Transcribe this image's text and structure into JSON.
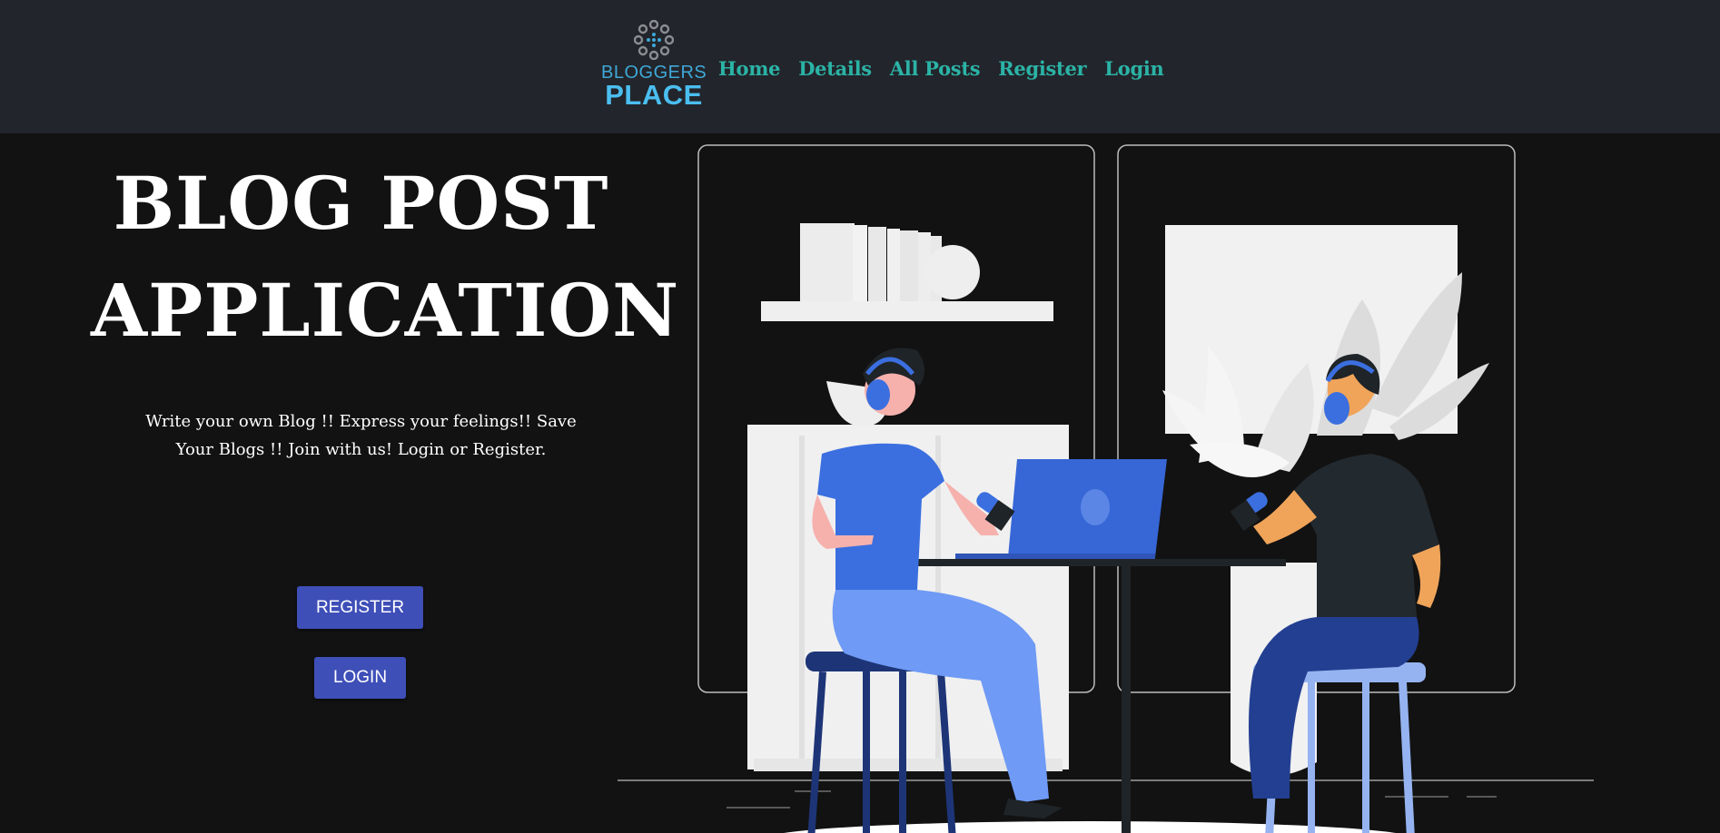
{
  "brand": {
    "line1": "BLOGGERS",
    "line2": "PLACE",
    "icon": "logo-dots-icon"
  },
  "nav": {
    "items": [
      {
        "label": "Home"
      },
      {
        "label": "Details"
      },
      {
        "label": "All Posts"
      },
      {
        "label": "Register"
      },
      {
        "label": "Login"
      }
    ]
  },
  "hero": {
    "title_line1": "BLOG POST",
    "title_line2": "APPLICATION",
    "subtitle": "Write your own Blog !! Express your feelings!! Save Your Blogs !! Join with us! Login or Register.",
    "register_label": "REGISTER",
    "login_label": "LOGIN",
    "illustration": "podcast-illustration"
  },
  "colors": {
    "navbar_bg": "#22252b",
    "page_bg": "#121212",
    "nav_link": "#2bb3a6",
    "button_bg": "#3f4fb8",
    "brand_accent": "#4bbef0"
  }
}
